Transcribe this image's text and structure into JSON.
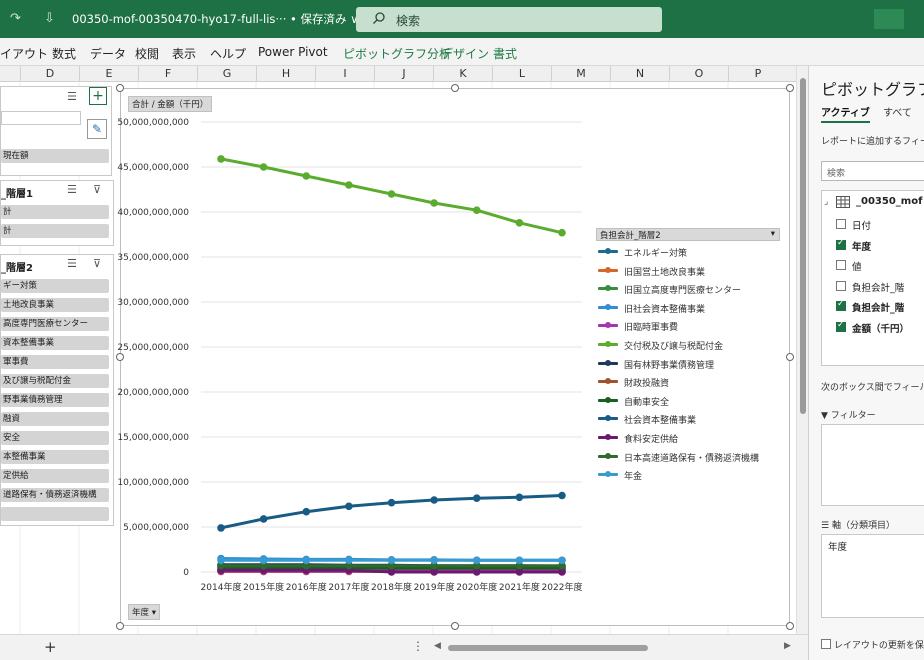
{
  "titlebar": {
    "redo_icon": "↷",
    "qat_icon": "⇩",
    "filename": "00350-mof-00350470-hyo17-full-lis···",
    "saved_status": "• 保存済み ∨",
    "search_placeholder": "検索"
  },
  "ribbon": {
    "tabs": [
      "イアウト",
      "数式",
      "データ",
      "校閲",
      "表示",
      "ヘルプ",
      "Power Pivot"
    ],
    "context_tabs": [
      "ピボットグラフ分析",
      "デザイン",
      "書式"
    ]
  },
  "columns": [
    "D",
    "E",
    "F",
    "G",
    "H",
    "I",
    "J",
    "K",
    "L",
    "M",
    "N",
    "O",
    "P"
  ],
  "slicers": [
    {
      "header": "",
      "items": [
        "",
        "現在額"
      ]
    },
    {
      "header": "_階層1",
      "items": [
        "計",
        "計"
      ]
    },
    {
      "header": "_階層2",
      "items": [
        "ギー対策",
        "土地改良事業",
        "高度専門医療センター",
        "資本整備事業",
        "軍事費",
        "及び譲与税配付金",
        "野事業債務管理",
        "融資",
        "安全",
        "本整備事業",
        "定供給",
        "道路保有・債務返済機構",
        ""
      ]
    }
  ],
  "chart": {
    "value_field_button": "合計 / 金額（千円）",
    "axis_field_button": "年度",
    "legend_field_button": "負担会計_階層2",
    "legend": [
      "エネルギー対策",
      "旧国営土地改良事業",
      "旧国立高度専門医療センター",
      "旧社会資本整備事業",
      "旧臨時軍事費",
      "交付税及び譲与税配付金",
      "国有林野事業債務管理",
      "財政投融資",
      "自動車安全",
      "社会資本整備事業",
      "食料安定供給",
      "日本高速道路保有・債務返済機構",
      "年金"
    ]
  },
  "chart_data": {
    "type": "line",
    "x": [
      "2014年度",
      "2015年度",
      "2016年度",
      "2017年度",
      "2018年度",
      "2019年度",
      "2020年度",
      "2021年度",
      "2022年度"
    ],
    "yticks": [
      "50,000,000,000",
      "45,000,000,000",
      "40,000,000,000",
      "35,000,000,000",
      "30,000,000,000",
      "25,000,000,000",
      "20,000,000,000",
      "15,000,000,000",
      "10,000,000,000",
      "5,000,000,000",
      "0"
    ],
    "ylim": [
      0,
      50000000000
    ],
    "grid": true,
    "legend_position": "right",
    "series": [
      {
        "name": "エネルギー対策",
        "color": "#1f6b8e",
        "values": [
          300000000,
          300000000,
          300000000,
          300000000,
          300000000,
          300000000,
          300000000,
          300000000,
          300000000
        ]
      },
      {
        "name": "旧国営土地改良事業",
        "color": "#d46a2a",
        "values": [
          50000000,
          50000000,
          50000000,
          50000000,
          50000000,
          50000000,
          50000000,
          50000000,
          50000000
        ]
      },
      {
        "name": "旧国立高度専門医療センター",
        "color": "#3a8d3a",
        "values": [
          150000000,
          150000000,
          150000000,
          150000000,
          150000000,
          150000000,
          150000000,
          150000000,
          150000000
        ]
      },
      {
        "name": "旧社会資本整備事業",
        "color": "#2e8fd3",
        "values": [
          1500000000,
          1450000000,
          1400000000,
          1400000000,
          1350000000,
          1350000000,
          1300000000,
          1300000000,
          1300000000
        ]
      },
      {
        "name": "旧臨時軍事費",
        "color": "#a832b0",
        "values": [
          100000000,
          100000000,
          100000000,
          100000000,
          100000000,
          100000000,
          100000000,
          100000000,
          100000000
        ]
      },
      {
        "name": "交付税及び譲与税配付金",
        "color": "#5aab2e",
        "values": [
          45900000000,
          45000000000,
          44000000000,
          43000000000,
          42000000000,
          41000000000,
          40200000000,
          38800000000,
          37700000000
        ]
      },
      {
        "name": "国有林野事業債務管理",
        "color": "#1d3a5f",
        "values": [
          800000000,
          800000000,
          800000000,
          750000000,
          750000000,
          700000000,
          700000000,
          700000000,
          650000000
        ]
      },
      {
        "name": "財政投融資",
        "color": "#a0522d",
        "values": [
          600000000,
          600000000,
          550000000,
          550000000,
          500000000,
          500000000,
          500000000,
          500000000,
          500000000
        ]
      },
      {
        "name": "自動車安全",
        "color": "#1b5e20",
        "values": [
          500000000,
          500000000,
          500000000,
          500000000,
          450000000,
          450000000,
          450000000,
          450000000,
          450000000
        ]
      },
      {
        "name": "社会資本整備事業",
        "color": "#185c86",
        "values": [
          4900000000,
          5900000000,
          6700000000,
          7300000000,
          7700000000,
          8000000000,
          8200000000,
          8300000000,
          8500000000
        ]
      },
      {
        "name": "食料安定供給",
        "color": "#6a1b6e",
        "values": [
          200000000,
          200000000,
          200000000,
          200000000,
          0,
          0,
          0,
          0,
          0
        ]
      },
      {
        "name": "日本高速道路保有・債務返済機構",
        "color": "#2f6b2f",
        "values": [
          700000000,
          700000000,
          700000000,
          700000000,
          700000000,
          700000000,
          700000000,
          700000000,
          700000000
        ]
      },
      {
        "name": "年金",
        "color": "#3a9bd0",
        "values": [
          1300000000,
          1300000000,
          1300000000,
          1300000000,
          1300000000,
          1300000000,
          1300000000,
          1300000000,
          1300000000
        ]
      }
    ]
  },
  "pane": {
    "title": "ピボットグラフの",
    "tab_active": "アクティブ",
    "tab_all": "すべて",
    "add_fields_note": "レポートに追加するフィール",
    "search_placeholder": "検索",
    "table_name": "_00350_mof",
    "fields": [
      {
        "label": "日付",
        "checked": false
      },
      {
        "label": "年度",
        "checked": true
      },
      {
        "label": "値",
        "checked": false
      },
      {
        "label": "負担会計_階",
        "checked": false
      },
      {
        "label": "負担会計_階",
        "checked": true
      },
      {
        "label": "金額（千円）",
        "checked": true
      }
    ],
    "drag_note": "次のボックス間でフィールド",
    "filter_label": "フィルター",
    "axis_label": "軸（分類項目）",
    "axis_value": "年度",
    "defer_label": "レイアウトの更新を保"
  }
}
